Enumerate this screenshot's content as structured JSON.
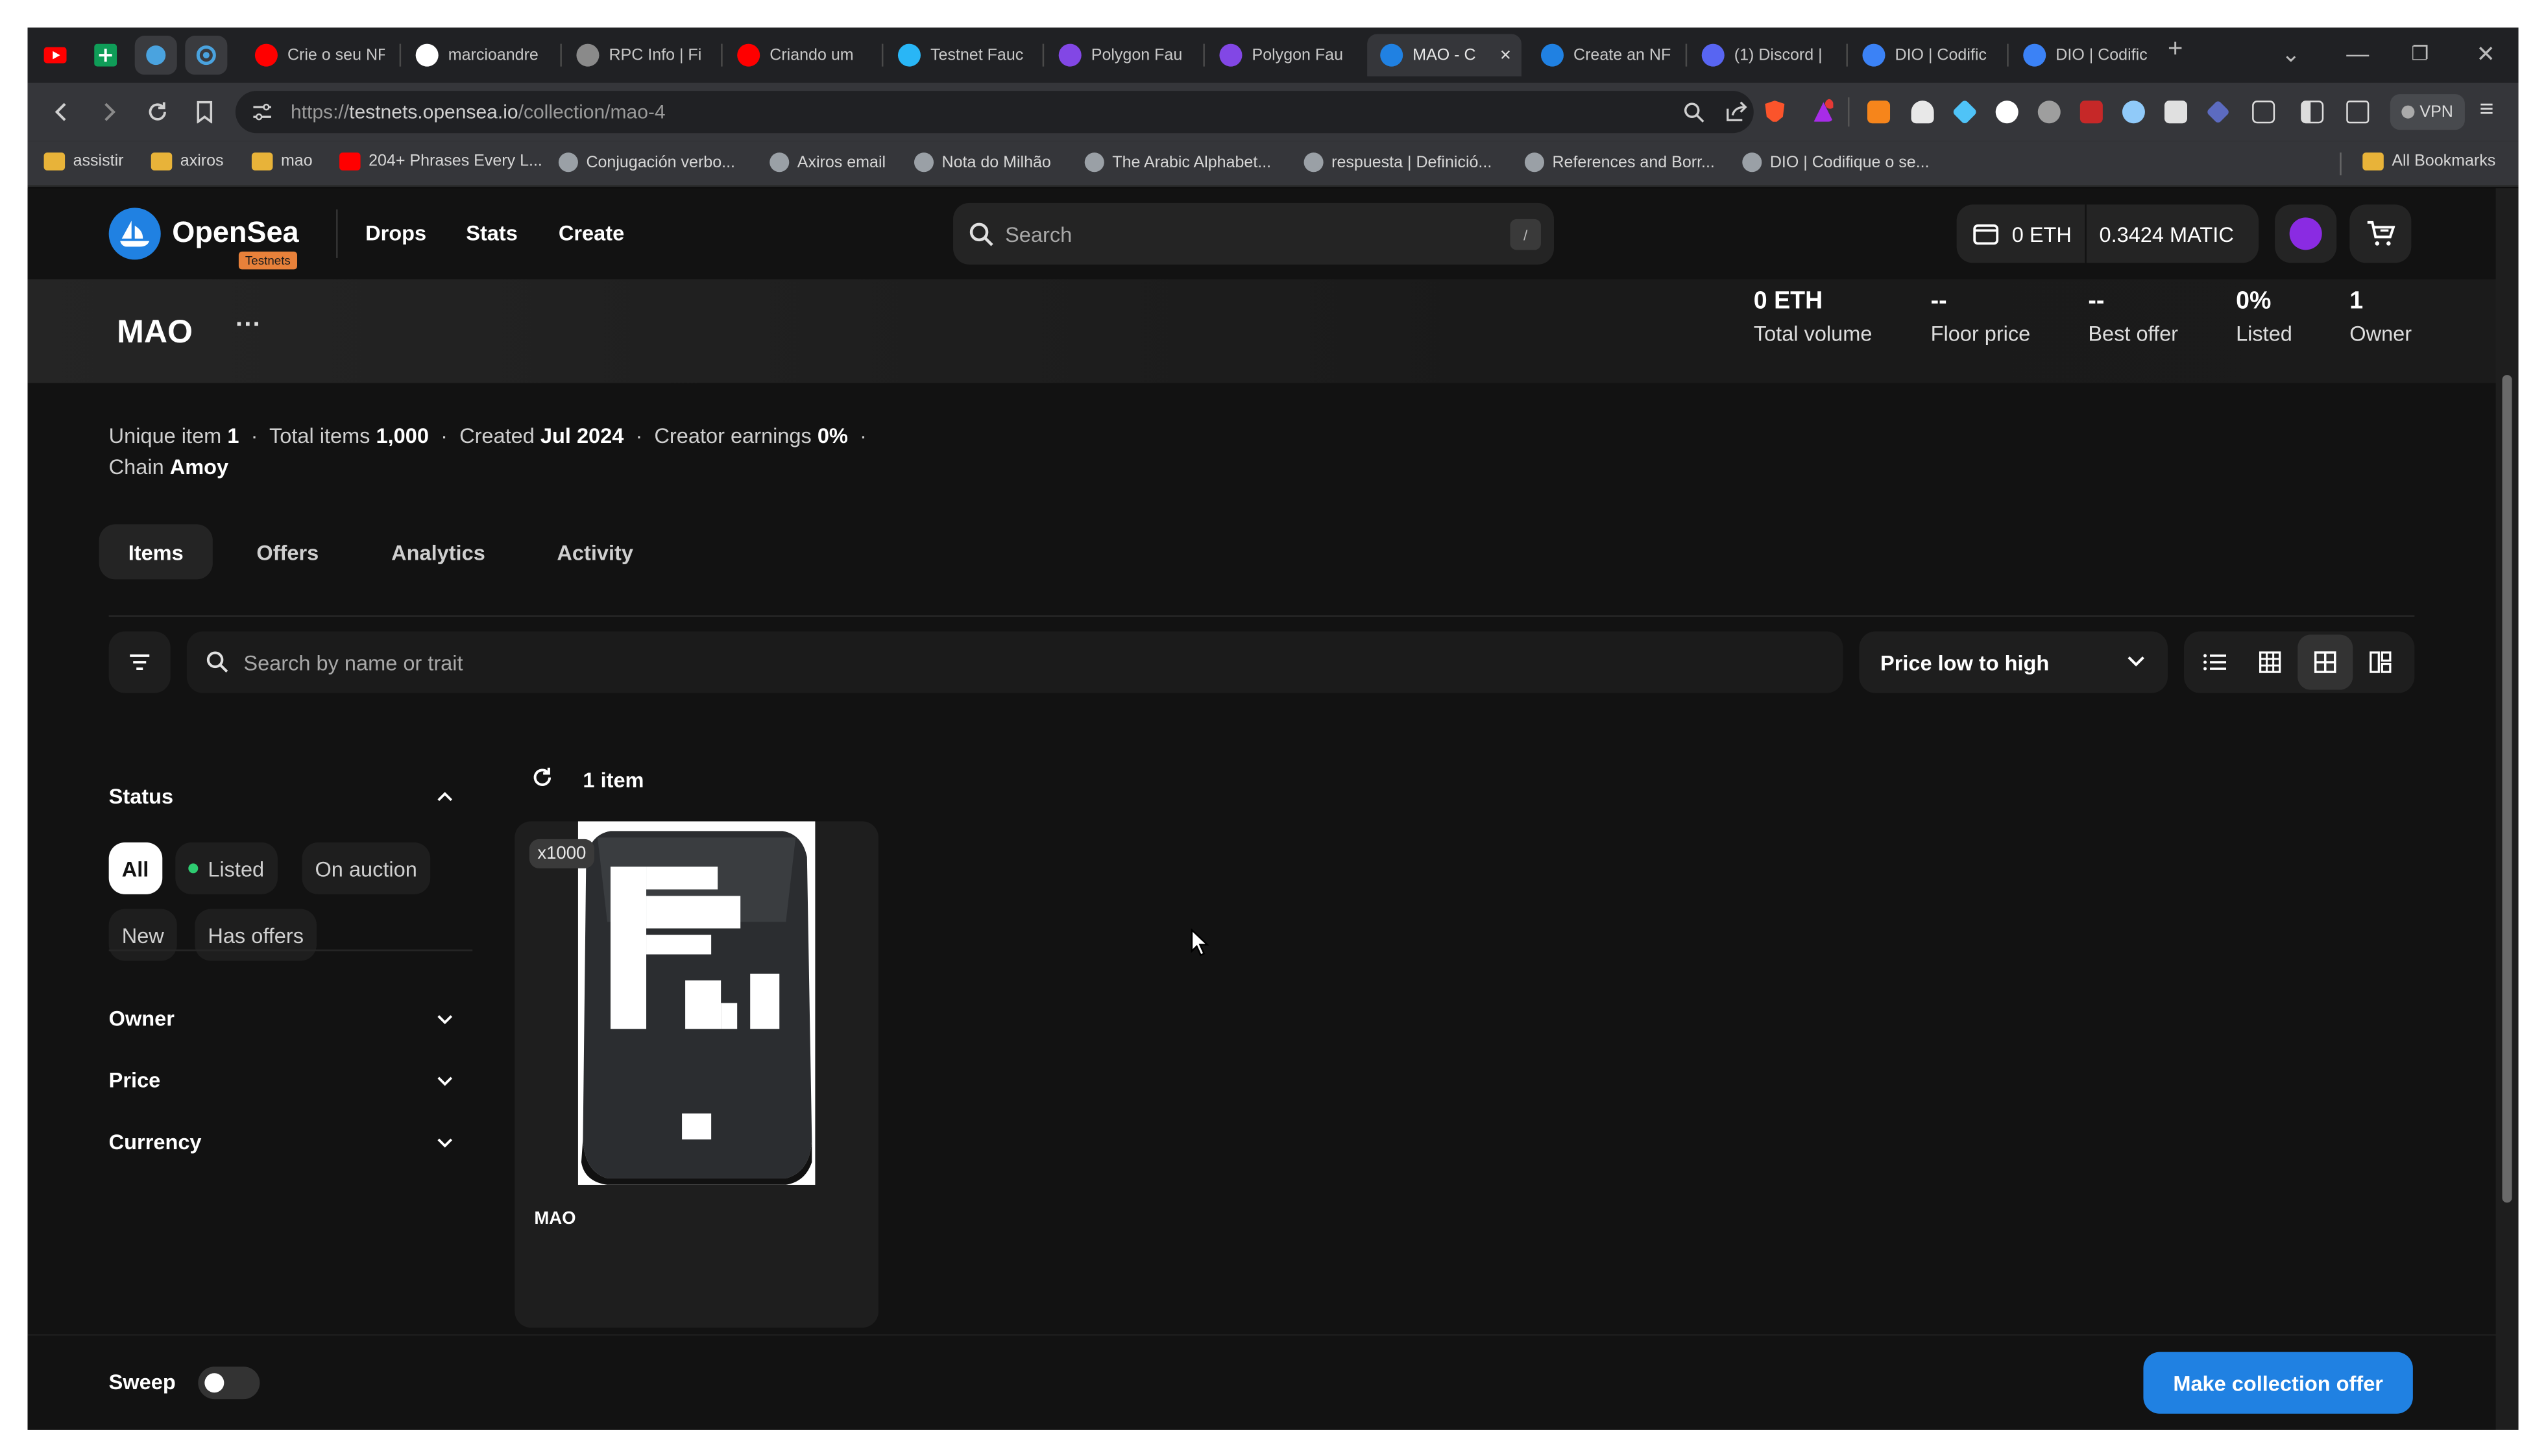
{
  "browser": {
    "tabs": [
      {
        "title": "Crie o seu NF",
        "favicon": "youtube-icon",
        "color": "#ff0000"
      },
      {
        "title": "marcioandre",
        "favicon": "github-icon",
        "color": "#ffffff"
      },
      {
        "title": "RPC Info | Fi",
        "favicon": "rpc-icon",
        "color": "#8a8a8a"
      },
      {
        "title": "Criando um",
        "favicon": "youtube-icon",
        "color": "#ff0000"
      },
      {
        "title": "Testnet Fauc",
        "favicon": "faucet-icon",
        "color": "#29b6f6"
      },
      {
        "title": "Polygon Fau",
        "favicon": "polygon-icon",
        "color": "#8247e5"
      },
      {
        "title": "Polygon Fau",
        "favicon": "polygon-icon",
        "color": "#8247e5"
      },
      {
        "title": "MAO - C",
        "favicon": "opensea-icon",
        "color": "#2081e2",
        "active": true
      },
      {
        "title": "Create an NF",
        "favicon": "opensea-icon",
        "color": "#2081e2"
      },
      {
        "title": "(1) Discord |",
        "favicon": "discord-icon",
        "color": "#5865f2"
      },
      {
        "title": "DIO | Codific",
        "favicon": "dio-icon",
        "color": "#3b82f6"
      },
      {
        "title": "DIO | Codific",
        "favicon": "dio-icon",
        "color": "#3b82f6"
      }
    ],
    "url_prefix": "https://",
    "url_host": "testnets.opensea.io",
    "url_path": "/collection/mao-4",
    "vpn_label": "VPN",
    "bookmarks": [
      {
        "label": "assistir",
        "type": "folder"
      },
      {
        "label": "axiros",
        "type": "folder"
      },
      {
        "label": "mao",
        "type": "folder"
      },
      {
        "label": "204+ Phrases Every L...",
        "type": "youtube"
      },
      {
        "label": "Conjugación verbo...",
        "type": "site"
      },
      {
        "label": "Axiros email",
        "type": "site"
      },
      {
        "label": "Nota do Milhão",
        "type": "site"
      },
      {
        "label": "The Arabic Alphabet...",
        "type": "site"
      },
      {
        "label": "respuesta | Definició...",
        "type": "site"
      },
      {
        "label": "References and Borr...",
        "type": "site"
      },
      {
        "label": "DIO | Codifique o se...",
        "type": "site"
      }
    ],
    "all_bookmarks": "All Bookmarks"
  },
  "header": {
    "brand": "OpenSea",
    "badge": "Testnets",
    "nav": [
      "Drops",
      "Stats",
      "Create"
    ],
    "search_placeholder": "Search",
    "search_shortcut": "/",
    "eth_balance": "0 ETH",
    "matic_balance": "0.3424 MATIC"
  },
  "collection": {
    "name": "MAO",
    "more": "···",
    "stats": [
      {
        "value": "0 ETH",
        "label": "Total volume"
      },
      {
        "value": "--",
        "label": "Floor price"
      },
      {
        "value": "--",
        "label": "Best offer"
      },
      {
        "value": "0%",
        "label": "Listed"
      },
      {
        "value": "1",
        "label": "Owner"
      }
    ],
    "meta": {
      "unique_label": "Unique item",
      "unique_value": "1",
      "total_label": "Total items",
      "total_value": "1,000",
      "created_label": "Created",
      "created_value": "Jul 2024",
      "earnings_label": "Creator earnings",
      "earnings_value": "0%",
      "chain_label": "Chain",
      "chain_value": "Amoy",
      "sep": "·"
    }
  },
  "page_tabs": [
    "Items",
    "Offers",
    "Analytics",
    "Activity"
  ],
  "filters": {
    "trait_placeholder": "Search by name or trait",
    "sort": "Price low to high",
    "status_title": "Status",
    "status_chips": [
      "All",
      "Listed",
      "On auction",
      "New",
      "Has offers"
    ],
    "sections": [
      "Owner",
      "Price",
      "Currency"
    ]
  },
  "results": {
    "count": "1 item",
    "items": [
      {
        "name": "MAO",
        "quantity": "x1000"
      }
    ]
  },
  "footer": {
    "sweep": "Sweep",
    "sweep_on": false,
    "offer_button": "Make collection offer"
  },
  "colors": {
    "accent": "#2081e2",
    "background": "#121212",
    "surface": "#1e1e1e",
    "avatar": "#8a2be2"
  }
}
